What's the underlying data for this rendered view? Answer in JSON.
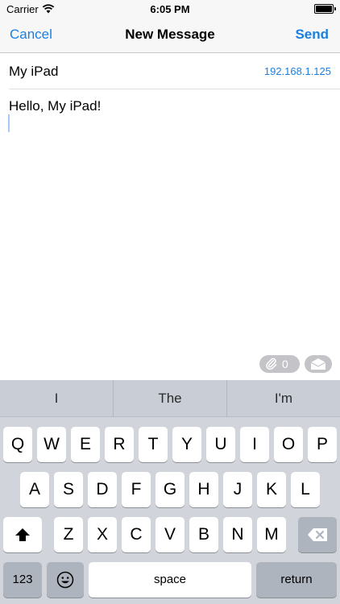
{
  "status_bar": {
    "carrier": "Carrier",
    "time": "6:05 PM"
  },
  "nav": {
    "cancel_label": "Cancel",
    "title": "New Message",
    "send_label": "Send"
  },
  "recipient": {
    "name": "My iPad",
    "ip": "192.168.1.125"
  },
  "message": {
    "text": "Hello, My iPad!"
  },
  "attachments": {
    "count": "0"
  },
  "suggestions": [
    "I",
    "The",
    "I'm"
  ],
  "keyboard": {
    "row1": [
      "Q",
      "W",
      "E",
      "R",
      "T",
      "Y",
      "U",
      "I",
      "O",
      "P"
    ],
    "row2": [
      "A",
      "S",
      "D",
      "F",
      "G",
      "H",
      "J",
      "K",
      "L"
    ],
    "row3": [
      "Z",
      "X",
      "C",
      "V",
      "B",
      "N",
      "M"
    ],
    "numbers_label": "123",
    "space_label": "space",
    "return_label": "return"
  },
  "colors": {
    "accent": "#1a7fe0",
    "keyboard_bg": "#d1d5db",
    "key_dark": "#aeb4bd"
  },
  "icons": {
    "wifi": "wifi-icon",
    "battery": "battery-icon",
    "attach": "paperclip-icon",
    "tray": "inbox-tray-icon",
    "shift": "shift-arrow-icon",
    "backspace": "backspace-icon",
    "emoji": "emoji-icon"
  }
}
